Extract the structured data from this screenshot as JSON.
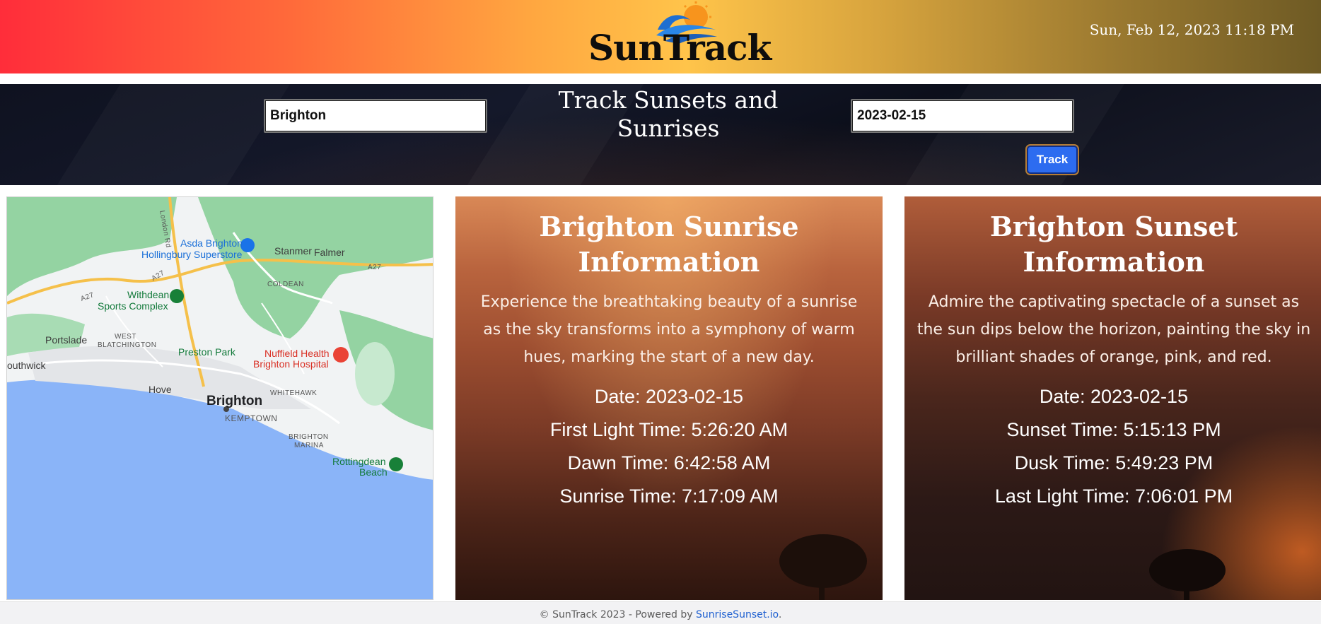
{
  "app": {
    "name": "SunTrack",
    "datetime": "Sun, Feb 12, 2023 11:18 PM"
  },
  "search": {
    "title": "Track Sunsets and Sunrises",
    "location_value": "Brighton",
    "date_value": "2023-02-15",
    "track_label": "Track"
  },
  "map": {
    "labels": {
      "london_rd": "London Rd",
      "asda": "Asda Brighton",
      "hollingbury": "Hollingbury Superstore",
      "stanmer": "Stanmer",
      "falmer": "Falmer",
      "coldean": "COLDEAN",
      "withdean": "Withdean",
      "sports_complex": "Sports Complex",
      "portslade": "Portslade",
      "west_blatchington": "WEST",
      "blatchington": "BLATCHINGTON",
      "preston_park": "Preston Park",
      "nuffield": "Nuffield Health",
      "brighton_hospital": "Brighton Hospital",
      "southwick": "outhwick",
      "hove": "Hove",
      "whitehawk": "WHITEHAWK",
      "brighton": "Brighton",
      "kemptown": "KEMPTOWN",
      "brighton_marina_1": "BRIGHTON",
      "brighton_marina_2": "MARINA",
      "rottingdean": "Rottingdean",
      "beach": "Beach",
      "a27_a": "A27",
      "a27_b": "A27",
      "a27_c": "A27"
    },
    "colors": {
      "sea": "#8ab4f8",
      "land": "#f1f3f4",
      "green": "#94d3a2",
      "road": "#f5c04a"
    }
  },
  "sunrise": {
    "title": "Brighton Sunrise Information",
    "description": "Experience the breathtaking beauty of a sunrise as the sky transforms into a symphony of warm hues, marking the start of a new day.",
    "date": "Date: 2023-02-15",
    "first_light": "First Light Time: 5:26:20 AM",
    "dawn": "Dawn Time: 6:42:58 AM",
    "sunrise": "Sunrise Time: 7:17:09 AM"
  },
  "sunset": {
    "title": "Brighton Sunset Information",
    "description": "Admire the captivating spectacle of a sunset as the sun dips below the horizon, painting the sky in brilliant shades of orange, pink, and red.",
    "date": "Date: 2023-02-15",
    "sunset": "Sunset Time: 5:15:13 PM",
    "dusk": "Dusk Time: 5:49:23 PM",
    "last_light": "Last Light Time: 7:06:01 PM"
  },
  "footer": {
    "copyright": "© SunTrack 2023 - Powered by ",
    "link_label": "SunriseSunset.io",
    "suffix": "."
  }
}
